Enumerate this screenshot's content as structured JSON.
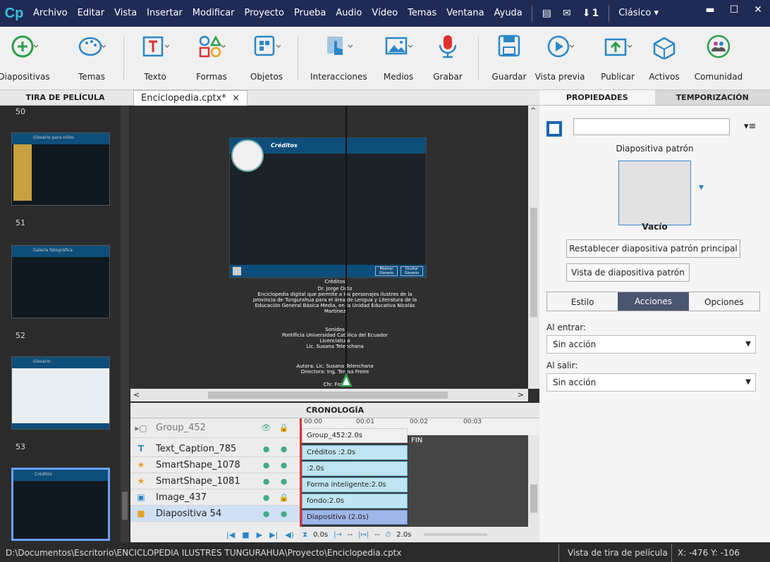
{
  "menubar": {
    "logo": "Cp",
    "items": [
      "Archivo",
      "Editar",
      "Vista",
      "Insertar",
      "Modificar",
      "Proyecto",
      "Prueba",
      "Audio",
      "Vídeo",
      "Temas",
      "Ventana",
      "Ayuda"
    ],
    "badge": "1",
    "mode": "Clásico"
  },
  "toolbar": {
    "buttons": [
      "Diapositivas",
      "Temas",
      "Texto",
      "Formas",
      "Objetos",
      "Interacciones",
      "Medios",
      "Grabar",
      "Guardar",
      "Vista previa",
      "Publicar",
      "Activos",
      "Comunidad"
    ]
  },
  "filmstrip": {
    "title": "TIRA DE PELÍCULA",
    "slides": [
      "50",
      "51",
      "52",
      "53"
    ],
    "thumb_titles": [
      "Glosario para niños",
      "Galería fotográfica",
      "Glosario",
      "Créditos"
    ]
  },
  "document": {
    "tab_label": "Enciclopedia.cptx*",
    "close_glyph": "×"
  },
  "stage": {
    "slide_title": "Créditos",
    "slide_footer_buttons": [
      "Mostrar Glosario",
      "Ocultar Glosario"
    ],
    "credits": {
      "heading": "Créditos",
      "author": "Dr. Jorge Ortiz",
      "description": "Enciclopedia digital que permite a los personajes ilustres de la provincia de Tungurahua para el área de Lengua y Literatura de la Educación General Básica Media, en la Unidad Educativa Nicolás Martínez",
      "sounds": "Sonidos",
      "university": "Pontificia Universidad Católica del Ecuador",
      "license": "Licenciatura",
      "lic": "Lic. Susana Telenchana",
      "autora": "Autora: Lic. Susana Telenchana",
      "directora": "Directora: Ing. Teresa Freire",
      "last": "Chr. Fond"
    }
  },
  "timeline": {
    "title": "CRONOLOGÍA",
    "ruler": [
      "00:00",
      "00:01",
      "00:02",
      "00:03"
    ],
    "rows": [
      {
        "name": "Group_452",
        "bar": "Group_452:2.0s"
      },
      {
        "name": "Text_Caption_785",
        "bar": "Créditos :2.0s"
      },
      {
        "name": "SmartShape_1078",
        "bar": ":2.0s"
      },
      {
        "name": "SmartShape_1081",
        "bar": "Forma inteligente:2.0s"
      },
      {
        "name": "Image_437",
        "bar": "fondo:2.0s"
      },
      {
        "name": "Diapositiva 54",
        "bar": "Diapositiva (2.0s)"
      }
    ],
    "end_label": "FIN",
    "footer": {
      "time": "0.0s",
      "a": "--",
      "b": "--",
      "duration": "2.0s"
    }
  },
  "properties": {
    "tabs": [
      "PROPIEDADES",
      "TEMPORIZACIÓN"
    ],
    "master_label": "Diapositiva patrón",
    "master_name": "Vacío",
    "reset_button": "Restablecer diapositiva patrón principal",
    "view_button": "Vista de diapositiva patrón",
    "subtabs": [
      "Estilo",
      "Acciones",
      "Opciones"
    ],
    "on_enter_label": "Al entrar:",
    "on_enter_value": "Sin acción",
    "on_exit_label": "Al salir:",
    "on_exit_value": "Sin acción"
  },
  "status": {
    "path": "D:\\Documentos\\Escritorio\\ENCICLOPEDIA ILUSTRES TUNGURAHUA\\Proyecto\\Enciclopedia.cptx",
    "view": "Vista de tira de película",
    "coords": "X: -476 Y: -106"
  },
  "colors": {
    "menubar": "#1f2a55",
    "accent": "#3ac0d8",
    "slide_blue": "#0d4e7a"
  }
}
